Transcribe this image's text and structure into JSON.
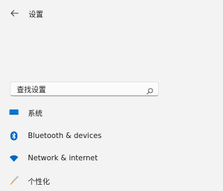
{
  "header": {
    "back_icon": "back-arrow-icon",
    "title": "设置"
  },
  "search": {
    "placeholder": "查找设置",
    "icon": "search-icon"
  },
  "sidebar": {
    "items": [
      {
        "label": "系统",
        "icon": "system-display-icon",
        "color": "#0078d4"
      },
      {
        "label": "Bluetooth & devices",
        "icon": "bluetooth-icon",
        "color": "#0067c0"
      },
      {
        "label": "Network & internet",
        "icon": "wifi-icon",
        "color": "#0067c0"
      },
      {
        "label": "个性化",
        "icon": "brush-icon",
        "color": "#e59a26"
      }
    ]
  }
}
